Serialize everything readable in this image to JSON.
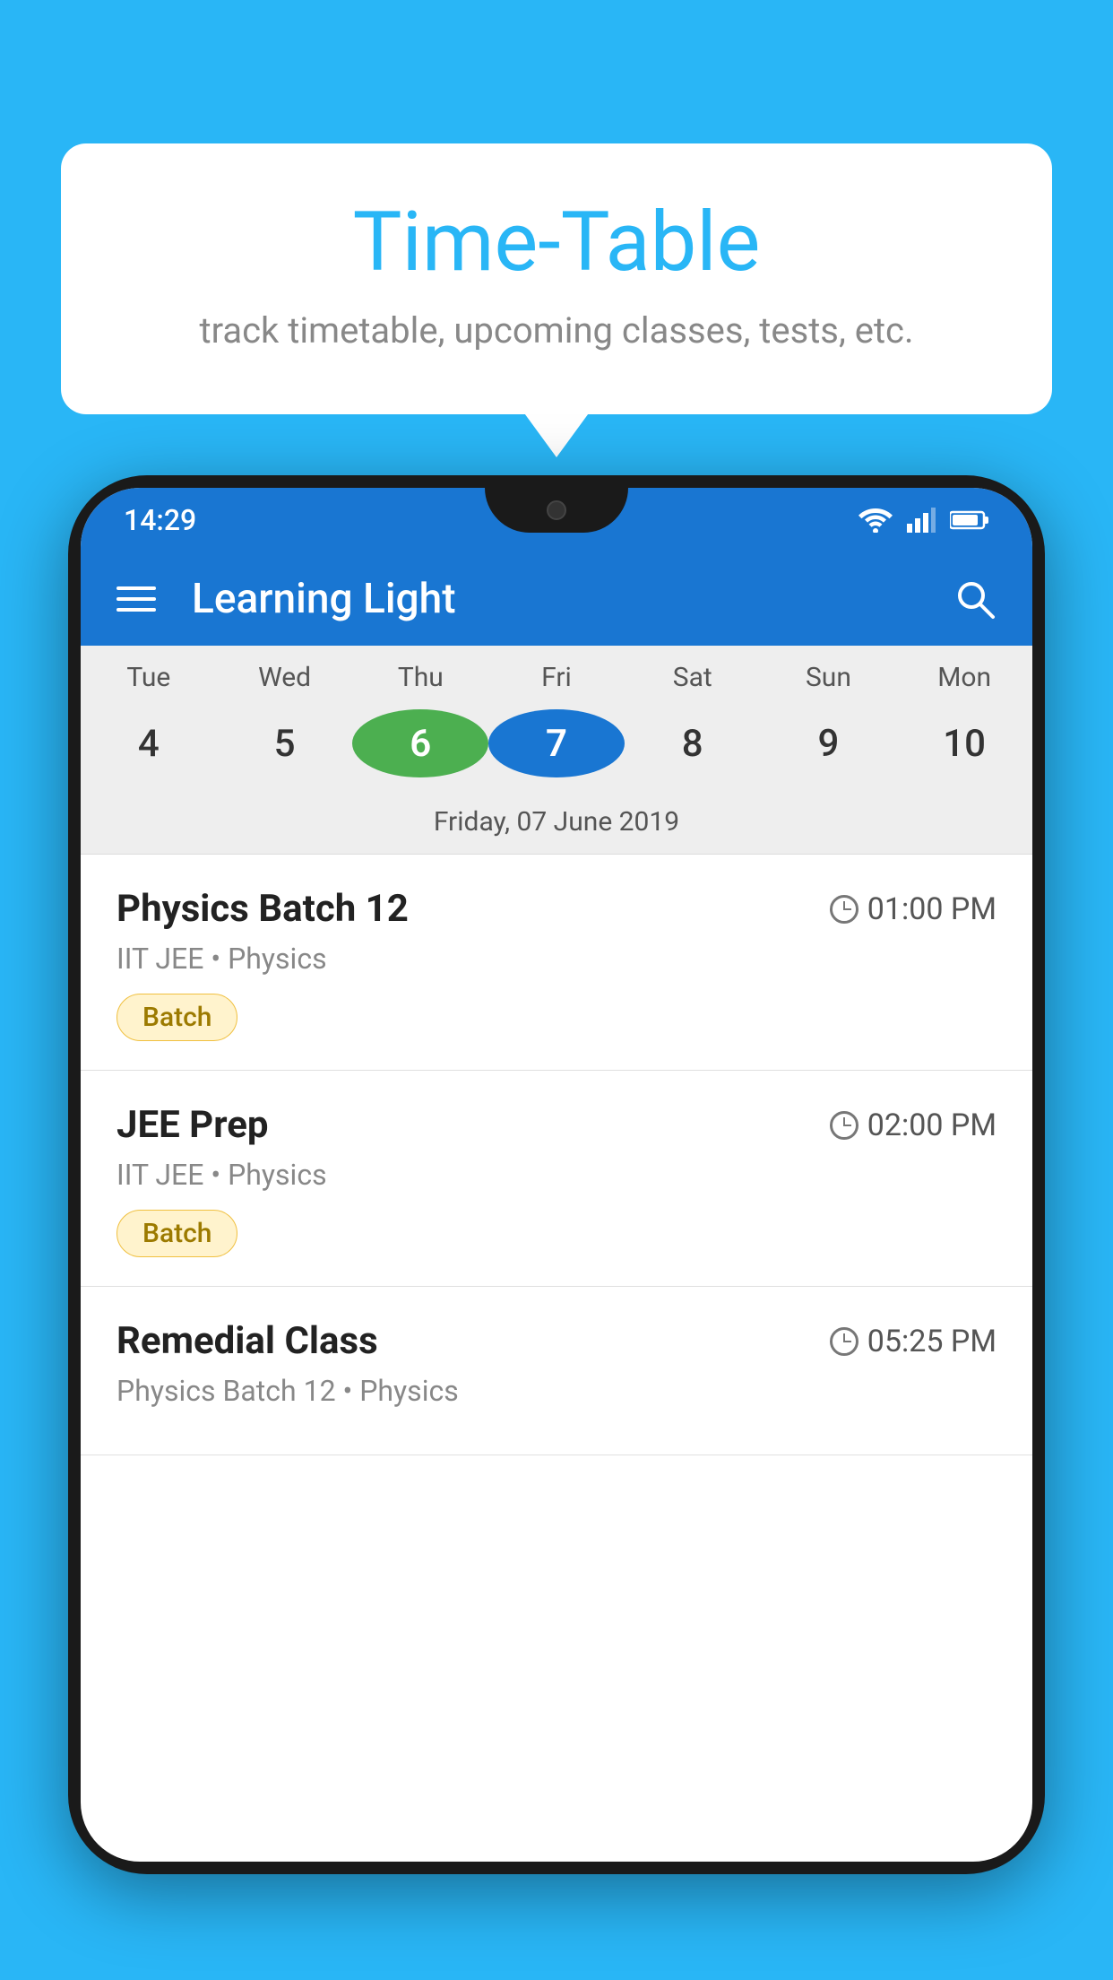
{
  "background_color": "#29B6F6",
  "bubble": {
    "title": "Time-Table",
    "subtitle": "track timetable, upcoming classes, tests, etc."
  },
  "phone": {
    "status_bar": {
      "time": "14:29"
    },
    "app_bar": {
      "title": "Learning Light"
    },
    "calendar": {
      "days": [
        {
          "abbr": "Tue",
          "num": "4",
          "state": "normal"
        },
        {
          "abbr": "Wed",
          "num": "5",
          "state": "normal"
        },
        {
          "abbr": "Thu",
          "num": "6",
          "state": "today"
        },
        {
          "abbr": "Fri",
          "num": "7",
          "state": "selected"
        },
        {
          "abbr": "Sat",
          "num": "8",
          "state": "normal"
        },
        {
          "abbr": "Sun",
          "num": "9",
          "state": "normal"
        },
        {
          "abbr": "Mon",
          "num": "10",
          "state": "normal"
        }
      ],
      "selected_date_label": "Friday, 07 June 2019"
    },
    "classes": [
      {
        "name": "Physics Batch 12",
        "time": "01:00 PM",
        "subtitle": "IIT JEE • Physics",
        "tag": "Batch"
      },
      {
        "name": "JEE Prep",
        "time": "02:00 PM",
        "subtitle": "IIT JEE • Physics",
        "tag": "Batch"
      },
      {
        "name": "Remedial Class",
        "time": "05:25 PM",
        "subtitle": "Physics Batch 12 • Physics",
        "tag": null
      }
    ]
  }
}
